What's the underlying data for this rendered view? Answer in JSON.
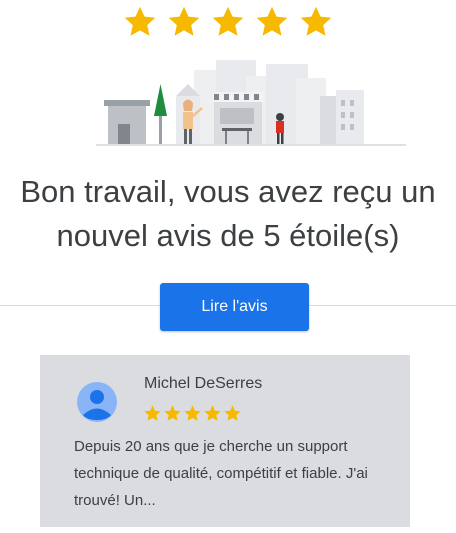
{
  "rating": {
    "stars": 5,
    "star_color": "#f6b900",
    "star_icon": "star-icon"
  },
  "headline": {
    "line1": "Bon travail, vous avez reçu un",
    "line2": "nouvel avis de 5 étoile(s)"
  },
  "cta": {
    "label": "Lire l'avis",
    "color": "#1a73e8"
  },
  "review": {
    "reviewer_name": "Michel DeSerres",
    "stars": 5,
    "text": "Depuis 20 ans que je cherche un support technique de qualité, compétitif et fiable. J'ai trouvé! Un...",
    "avatar_icon": "person-avatar-icon"
  }
}
